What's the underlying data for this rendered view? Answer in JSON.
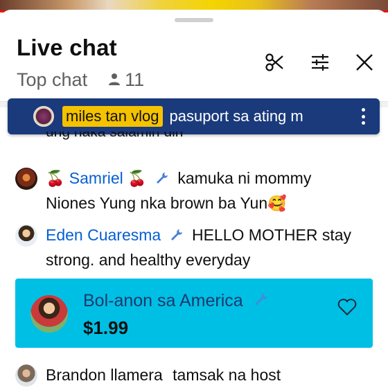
{
  "header": {
    "title": "Live chat",
    "mode": "Top chat",
    "viewer_count": "11",
    "icons": [
      "scissors-icon",
      "tune-icon",
      "close-icon"
    ]
  },
  "pinned": {
    "name": "miles tan vlog",
    "message": "pasuport sa ating m"
  },
  "messages": [
    {
      "text": "ung naka salamin din"
    },
    {
      "author": "Samriel",
      "emoji_before": "🍒",
      "emoji_after": "🍒",
      "text": "kamuka ni mommy",
      "text2": "Niones Yung nka brown ba Yun",
      "emoji_end": "🥰"
    },
    {
      "author": "Eden Cuaresma",
      "text": "HELLO MOTHER stay",
      "text2": "strong. and healthy everyday"
    },
    {
      "author": "Brandon llamera",
      "text": "tamsak na host"
    }
  ],
  "superchat": {
    "name": "Bol-anon sa America",
    "amount": "$1.99",
    "color": "#00bfe5"
  },
  "colors": {
    "author_link": "#065fd4",
    "pinned_bg": "#1a3a7c",
    "pinned_name_bg": "#f5c200"
  }
}
